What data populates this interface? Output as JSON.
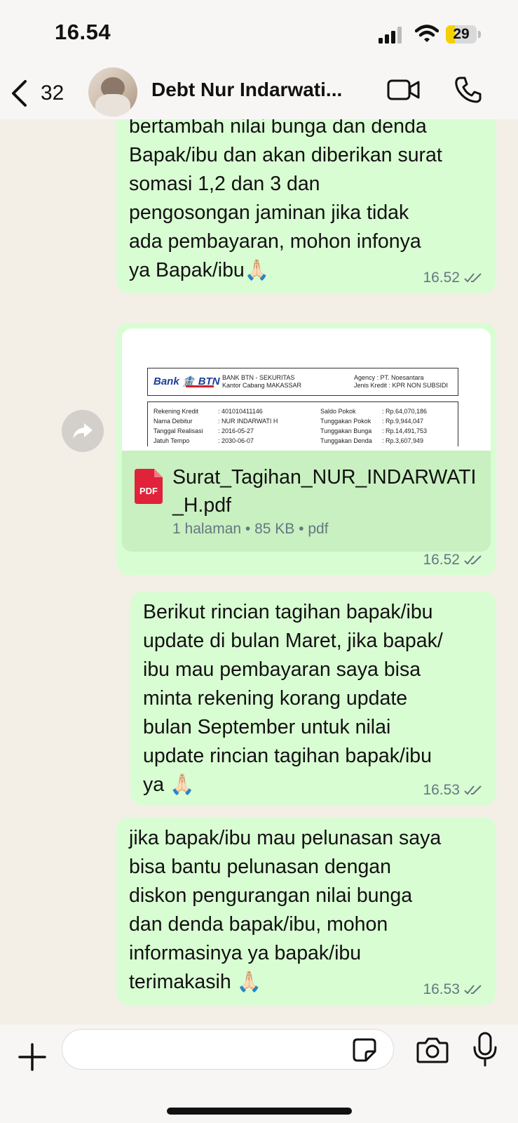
{
  "status_bar": {
    "time": "16.54",
    "battery": "29",
    "battery_level": 0.29
  },
  "header": {
    "back_count": "32",
    "contact_name": "Debt Nur Indarwati..."
  },
  "messages": [
    {
      "text": "bertambah nilai bunga dan denda\nBapak/ibu dan akan diberikan surat\nsomasi 1,2 dan 3 dan\npengosongan jaminan jika tidak\nada pembayaran, mohon infonya\nya Bapak/ibu🙏🏻",
      "time": "16.52"
    },
    {
      "type": "document",
      "preview": {
        "bank_logo": "Bank",
        "bank_logo_brand": "BTN",
        "header_left": [
          "BANK BTN - SEKURITAS",
          "Kantor Cabang MAKASSAR"
        ],
        "header_right": [
          "Agency        : PT. Noesantara",
          "Jenis Kredit : KPR NON SUBSIDI"
        ],
        "col1": [
          "Rekening Kredit",
          "Nama Debitur",
          "Tanggal Realisasi",
          "Jatuh Tempo"
        ],
        "col2": [
          ": 401010411146",
          ": NUR INDARWATI H",
          ": 2016-05-27",
          ": 2030-06-07"
        ],
        "col3": [
          "Saldo Pokok",
          "Tunggakan Pokok",
          "Tunggakan Bunga",
          "Tunggakan Denda"
        ],
        "col4": [
          ": Rp.64,070,186",
          ": Rp.9,944,047",
          ": Rp.14,491,753",
          ": Rp.3,607,949"
        ]
      },
      "pdf_label": "PDF",
      "filename": "Surat_Tagihan_NUR_INDARWATI_H.pdf",
      "meta": "1 halaman • 85 KB • pdf",
      "time": "16.52"
    },
    {
      "text": "Berikut rincian tagihan bapak/ibu\nupdate di bulan Maret, jika bapak/\nibu mau pembayaran saya bisa\nminta rekening korang update\nbulan September untuk nilai\nupdate rincian tagihan bapak/ibu\nya 🙏🏻",
      "time": "16.53"
    },
    {
      "text": "jika bapak/ibu mau pelunasan saya\nbisa bantu pelunasan dengan\ndiskon pengurangan nilai bunga\ndan denda bapak/ibu, mohon\ninformasinya ya bapak/ibu\nterimakasih 🙏🏻",
      "time": "16.53"
    }
  ],
  "input": {
    "placeholder": ""
  },
  "colors": {
    "bubble": "#d9fdd3",
    "doc_info": "#c8f0c0",
    "background": "#f3efe7",
    "pdf_red": "#e0223a",
    "bank_blue": "#1b3f9b"
  }
}
